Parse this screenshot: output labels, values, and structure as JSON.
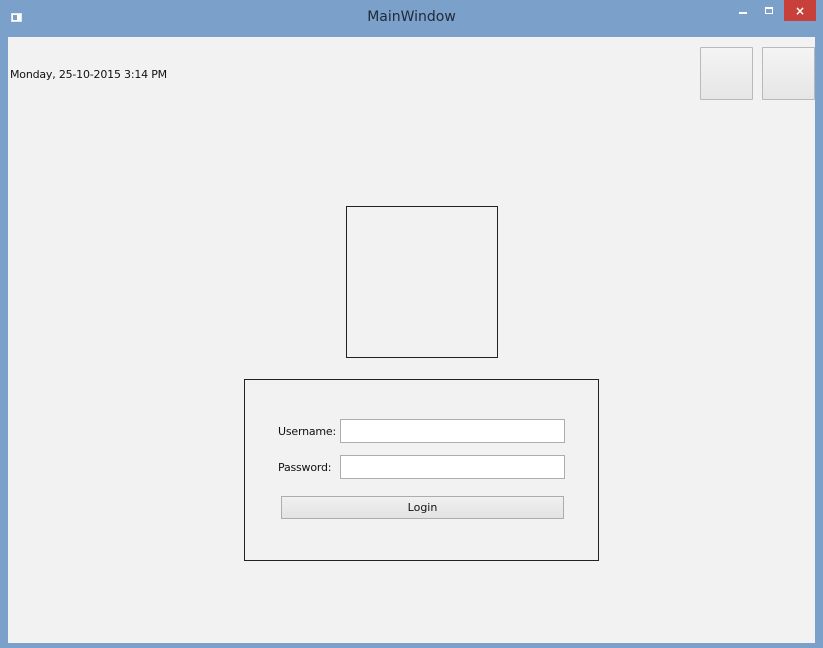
{
  "window": {
    "title": "MainWindow",
    "icon": "app-window-icon",
    "controls": {
      "minimize": "minimize-icon",
      "maximize": "maximize-icon",
      "close": "×"
    }
  },
  "header": {
    "datetime": "Monday, 25-10-2015 3:14 PM"
  },
  "login": {
    "username_label": "Username:",
    "username_value": "",
    "password_label": "Password:",
    "password_value": "",
    "login_label": "Login"
  },
  "colors": {
    "titlebar": "#7ba0c9",
    "close_button": "#c7403a",
    "client_background": "#f2f2f2"
  }
}
